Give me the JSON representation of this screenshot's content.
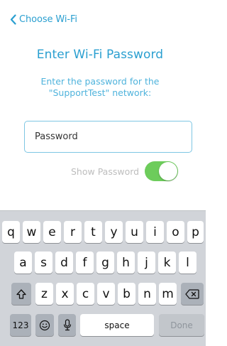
{
  "header": {
    "back_label": "Choose Wi-Fi"
  },
  "main": {
    "title": "Enter Wi-Fi Password",
    "subtitle_line1": "Enter the password for the",
    "subtitle_line2": "\"SupportTest\" network:",
    "password_placeholder": "Password",
    "password_value": "",
    "show_password_label": "Show Password",
    "show_password_on": true
  },
  "keyboard": {
    "row1": [
      "q",
      "w",
      "e",
      "r",
      "t",
      "y",
      "u",
      "i",
      "o",
      "p"
    ],
    "row2": [
      "a",
      "s",
      "d",
      "f",
      "g",
      "h",
      "j",
      "k",
      "l"
    ],
    "row3": [
      "z",
      "x",
      "c",
      "v",
      "b",
      "n",
      "m"
    ],
    "numbers_label": "123",
    "space_label": "space",
    "done_label": "Done",
    "icons": {
      "shift": "shift-icon",
      "delete": "backspace-icon",
      "emoji": "emoji-icon",
      "mic": "microphone-icon",
      "back": "chevron-left-icon"
    }
  },
  "colors": {
    "accent": "#2a9fd0",
    "subtitle": "#4fb3dc",
    "toggle_on": "#6dcc5b",
    "keyboard_bg": "#d1d4d9",
    "function_key": "#abb1b9"
  }
}
